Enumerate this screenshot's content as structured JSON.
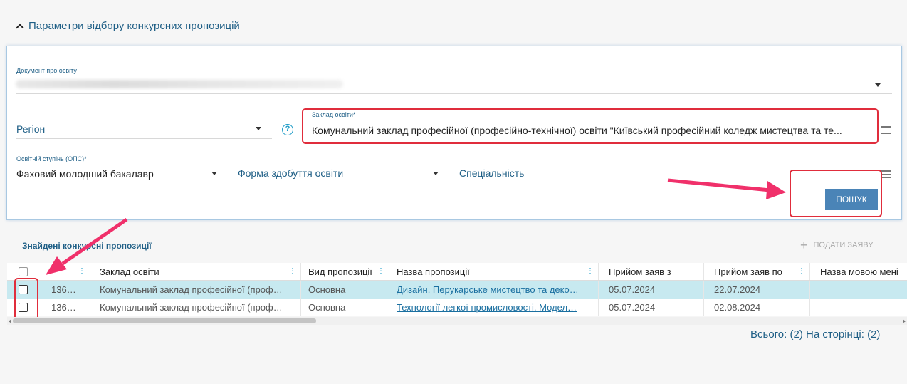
{
  "section": {
    "title": "Параметри відбору конкурсних пропозицій"
  },
  "filters": {
    "education_document": {
      "label": "Документ про освіту"
    },
    "region": {
      "value": "Регіон"
    },
    "institution": {
      "label": "Заклад освіти*",
      "value": "Комунальний заклад професійної (професійно-технічної) освіти \"Київський професійний коледж мистецтва та те..."
    },
    "degree": {
      "label": "Освітній ступінь (ОПС)*",
      "value": "Фаховий молодший бакалавр"
    },
    "study_form": {
      "value": "Форма здобуття освіти"
    },
    "specialty": {
      "value": "Спеціальність"
    },
    "search_button": "ПОШУК"
  },
  "results": {
    "title": "Знайдені конкурсні пропозиції",
    "apply_button": "ПОДАТИ ЗАЯВУ",
    "columns": [
      "Заклад освіти",
      "Вид пропозиції",
      "Назва пропозиції",
      "Прийом заяв з",
      "Прийом заяв по",
      "Назва мовою мені"
    ],
    "rows": [
      {
        "id": "136…",
        "institution": "Комунальний заклад професійної (проф…",
        "type": "Основна",
        "name": "Дизайн. Перукарське мистецтво та деко…",
        "from": "05.07.2024",
        "to": "22.07.2024",
        "selected": true
      },
      {
        "id": "136…",
        "institution": "Комунальний заклад професійної (проф…",
        "type": "Основна",
        "name": "Технології легкої промисловості. Модел…",
        "from": "05.07.2024",
        "to": "02.08.2024",
        "selected": false
      }
    ],
    "footer": "Всього: (2) На сторінці: (2)"
  },
  "colors": {
    "accent": "#1f5f86",
    "button": "#4a84b7",
    "highlight": "#e02d3c",
    "selected_row": "#c7e9f0"
  }
}
